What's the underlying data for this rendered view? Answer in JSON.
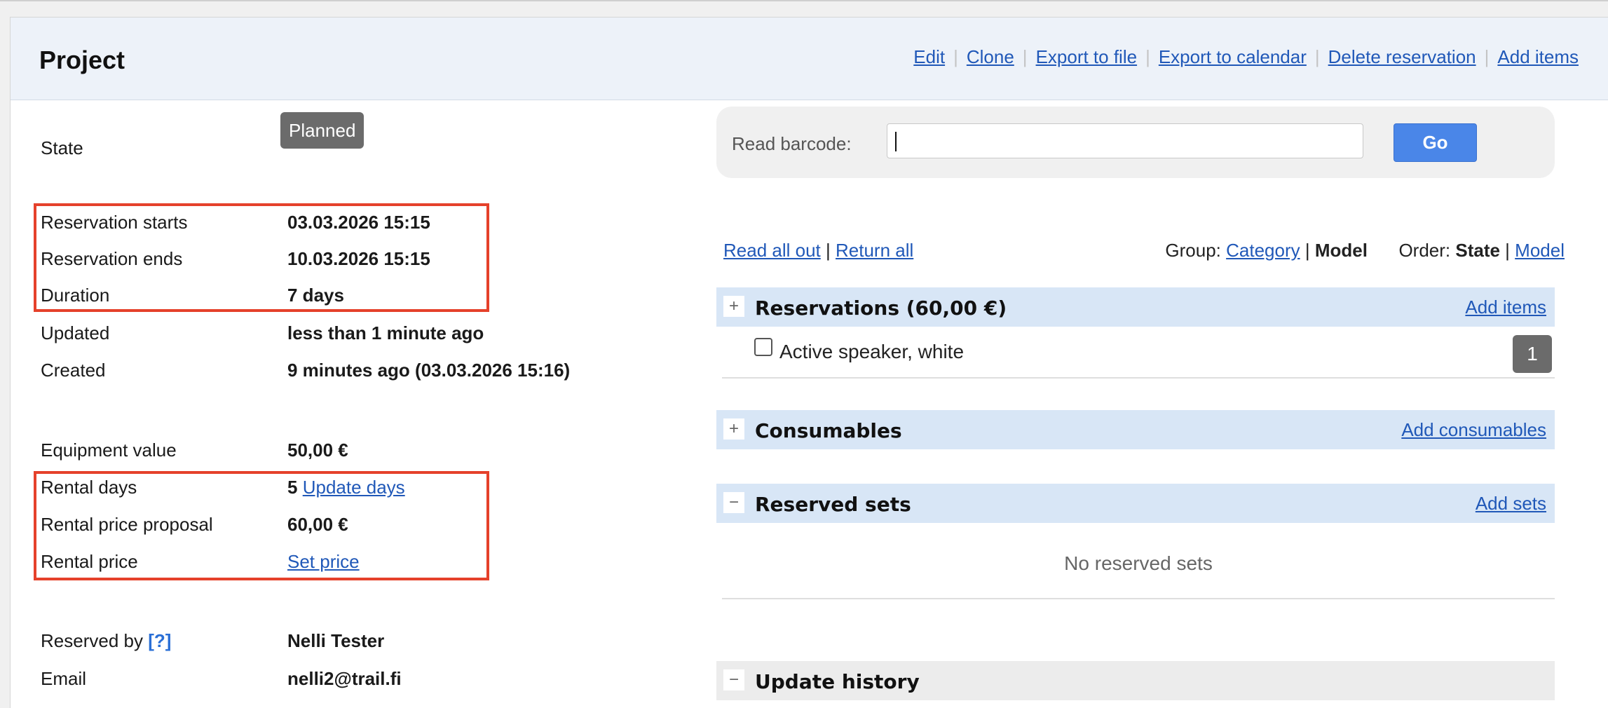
{
  "header": {
    "title": "Project",
    "actions": [
      "Edit",
      "Clone",
      "Export to file",
      "Export to calendar",
      "Delete reservation",
      "Add items"
    ]
  },
  "details": {
    "state_label": "State",
    "state_value": "Planned",
    "reservation_starts_label": "Reservation starts",
    "reservation_starts_value": "03.03.2026 15:15",
    "reservation_ends_label": "Reservation ends",
    "reservation_ends_value": "10.03.2026 15:15",
    "duration_label": "Duration",
    "duration_value": "7 days",
    "updated_label": "Updated",
    "updated_value": "less than 1 minute ago",
    "created_label": "Created",
    "created_value": "9 minutes ago (03.03.2026 15:16)",
    "equipment_value_label": "Equipment value",
    "equipment_value_value": "50,00 €",
    "rental_days_label": "Rental days",
    "rental_days_value": "5",
    "update_days_link": "Update days",
    "rental_price_proposal_label": "Rental price proposal",
    "rental_price_proposal_value": "60,00 €",
    "rental_price_label": "Rental price",
    "set_price_link": "Set price",
    "reserved_by_label": "Reserved by",
    "reserved_by_help": "[?]",
    "reserved_by_value": "Nelli Tester",
    "email_label": "Email",
    "email_value": "nelli2@trail.fi"
  },
  "barcode": {
    "label": "Read barcode:",
    "value": "",
    "placeholder": "",
    "go_label": "Go"
  },
  "toolbar": {
    "read_all_out": "Read all out",
    "separator": "|",
    "return_all": "Return all",
    "group_label": "Group:",
    "group_category": "Category",
    "group_model": "Model",
    "order_label": "Order:",
    "order_state": "State",
    "order_model": "Model"
  },
  "sections": {
    "reservations": {
      "toggle": "+",
      "title": "Reservations (60,00 €)",
      "link": "Add items"
    },
    "consumables": {
      "toggle": "+",
      "title": "Consumables",
      "link": "Add consumables"
    },
    "reserved_sets": {
      "toggle": "−",
      "title": "Reserved sets",
      "link": "Add sets",
      "empty": "No reserved sets"
    },
    "update_history": {
      "toggle": "−",
      "title": "Update history"
    }
  },
  "reservation_items": [
    {
      "name": "Active speaker, white",
      "count": "1",
      "checked": false
    }
  ],
  "colors": {
    "link": "#2058b8",
    "highlight_box": "#e5412b",
    "go_button": "#4a86e8",
    "section_bar": "#d8e6f6",
    "badge": "#6b6b6b"
  }
}
